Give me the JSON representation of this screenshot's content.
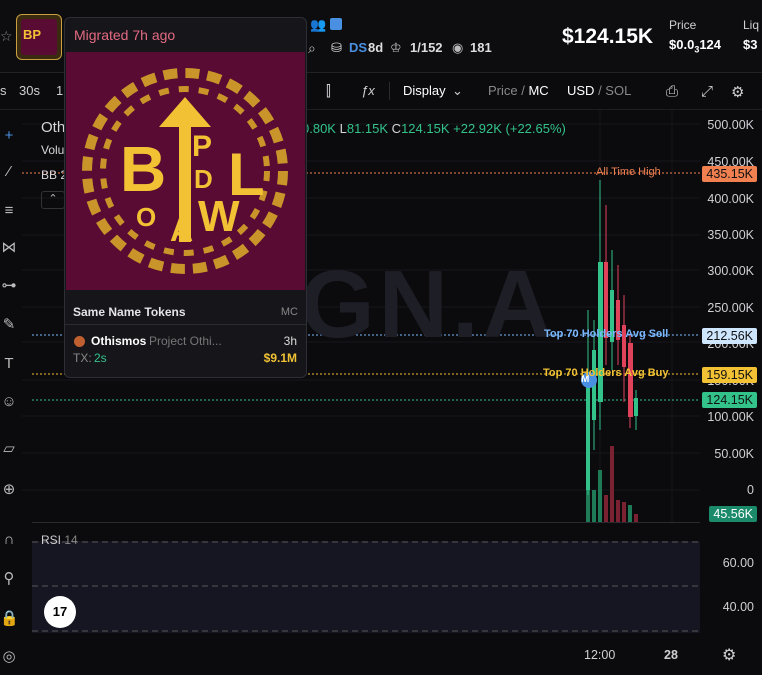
{
  "header": {
    "token_letters": "BP",
    "stats": {
      "ds_label": "DS",
      "ds_age": "8d",
      "holders_ratio": "1/152",
      "views": "181"
    },
    "market_cap": "$124.15K",
    "price_label": "Price",
    "price_value_prefix": "$0.0",
    "price_value_sub": "3",
    "price_value_suffix": "124",
    "liq_label": "Liq",
    "liq_value": "$3"
  },
  "toolbar": {
    "intervals": [
      "s",
      "30s",
      "1"
    ],
    "display_label": "Display",
    "price_mc_1": "Price",
    "price_mc_sep": " / ",
    "price_mc_2": "MC",
    "currency_1": "USD",
    "currency_sep": " / ",
    "currency_2": "SOL"
  },
  "chart": {
    "legend_name": "Oth",
    "legend_vol": "Volu",
    "legend_bb": "BB 2",
    "ohlc_h": "0.80K",
    "ohlc_l_label": "L",
    "ohlc_l": "81.15K",
    "ohlc_c_label": "C",
    "ohlc_c": "124.15K",
    "ohlc_change": "+22.92K (+22.65%)",
    "watermark": "GN.A",
    "y_ticks": [
      "500.00K",
      "450.00K",
      "400.00K",
      "350.00K",
      "300.00K",
      "250.00K",
      "200.00K",
      "150.00K",
      "100.00K",
      "50.00K",
      "0"
    ],
    "ath_label": "All Time High",
    "ath_value": "435.15K",
    "avg_sell_label": "Top 70 Holders Avg Sell",
    "avg_sell_value": "212.56K",
    "avg_buy_label": "Top 70 Holders Avg Buy",
    "avg_buy_value": "159.15K",
    "current_value": "124.15K",
    "volume_value": "45.56K",
    "m_marker": "M",
    "rsi_label": "RSI",
    "rsi_period": "14",
    "rsi_ticks": [
      "60.00",
      "40.00"
    ],
    "x_ticks": [
      "12:00",
      "28"
    ],
    "tv_logo": "17"
  },
  "popup": {
    "migrated": "Migrated 7h ago",
    "section_title": "Same Name Tokens",
    "mc_header": "MC",
    "token_name": "Othismos",
    "token_sub": "Project Othi...",
    "age": "3h",
    "tx_label": "TX:",
    "tx_value": "2s",
    "mcap": "$9.1M",
    "logo_letters": [
      "B",
      "P",
      "D",
      "L",
      "W",
      "O",
      "A"
    ]
  },
  "colors": {
    "up": "#33c38a",
    "down": "#e0425a",
    "ath": "#f08050",
    "sell": "#7ab8ff",
    "buy": "#f2c234",
    "accent": "#4a90e2"
  }
}
